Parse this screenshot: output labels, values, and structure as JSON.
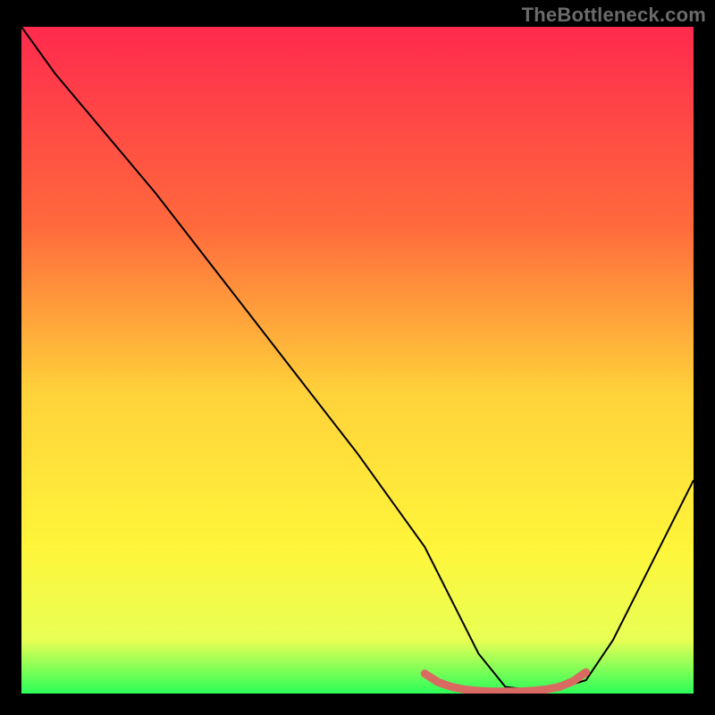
{
  "watermark": "TheBottleneck.com",
  "chart_data": {
    "type": "line",
    "title": "",
    "xlabel": "",
    "ylabel": "",
    "xlim": [
      0,
      100
    ],
    "ylim": [
      0,
      100
    ],
    "grid": false,
    "legend": false,
    "gradient": {
      "stops": [
        {
          "offset": 0,
          "color": "#ff2a4e"
        },
        {
          "offset": 30,
          "color": "#ff6a3c"
        },
        {
          "offset": 55,
          "color": "#ffd23a"
        },
        {
          "offset": 78,
          "color": "#fff53a"
        },
        {
          "offset": 92,
          "color": "#e8ff55"
        },
        {
          "offset": 100,
          "color": "#2bff59"
        }
      ]
    },
    "series": [
      {
        "name": "curve",
        "style": "thin-black",
        "x": [
          0,
          5,
          10,
          20,
          30,
          40,
          50,
          55,
          60,
          64,
          68,
          72,
          76,
          80,
          84,
          88,
          92,
          96,
          100
        ],
        "y": [
          100,
          93,
          87,
          75,
          62,
          49,
          36,
          29,
          22,
          14,
          6,
          1,
          0.5,
          0.8,
          2,
          8,
          16,
          24,
          32
        ]
      },
      {
        "name": "optimal-band-marker",
        "style": "thick-red",
        "x": [
          60,
          62,
          64,
          66,
          68,
          70,
          72,
          74,
          76,
          78,
          80,
          82,
          84
        ],
        "y": [
          3,
          1.7,
          1.0,
          0.6,
          0.4,
          0.3,
          0.3,
          0.3,
          0.4,
          0.6,
          1.0,
          1.8,
          3.2
        ]
      }
    ]
  }
}
